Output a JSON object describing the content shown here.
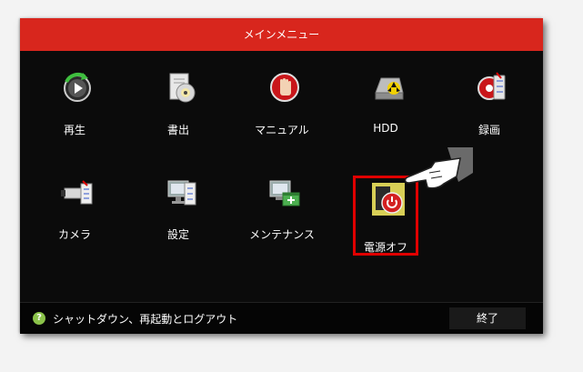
{
  "window": {
    "title": "メインメニュー"
  },
  "menu": {
    "items": [
      {
        "label": "再生",
        "icon": "playback-icon"
      },
      {
        "label": "書出",
        "icon": "export-disc-icon"
      },
      {
        "label": "マニュアル",
        "icon": "manual-hand-icon"
      },
      {
        "label": "HDD",
        "icon": "hdd-icon"
      },
      {
        "label": "録画",
        "icon": "record-icon"
      },
      {
        "label": "カメラ",
        "icon": "camera-icon"
      },
      {
        "label": "設定",
        "icon": "settings-icon"
      },
      {
        "label": "メンテナンス",
        "icon": "maintenance-icon"
      },
      {
        "label": "電源オフ",
        "icon": "power-off-icon"
      }
    ],
    "highlighted": "電源オフ"
  },
  "status": {
    "help_text": "シャットダウン、再起動とログアウト"
  },
  "buttons": {
    "exit_label": "終了"
  },
  "colors": {
    "title_bar": "#d8261d",
    "background": "#0b0b0b",
    "highlight_border": "#e00000"
  }
}
